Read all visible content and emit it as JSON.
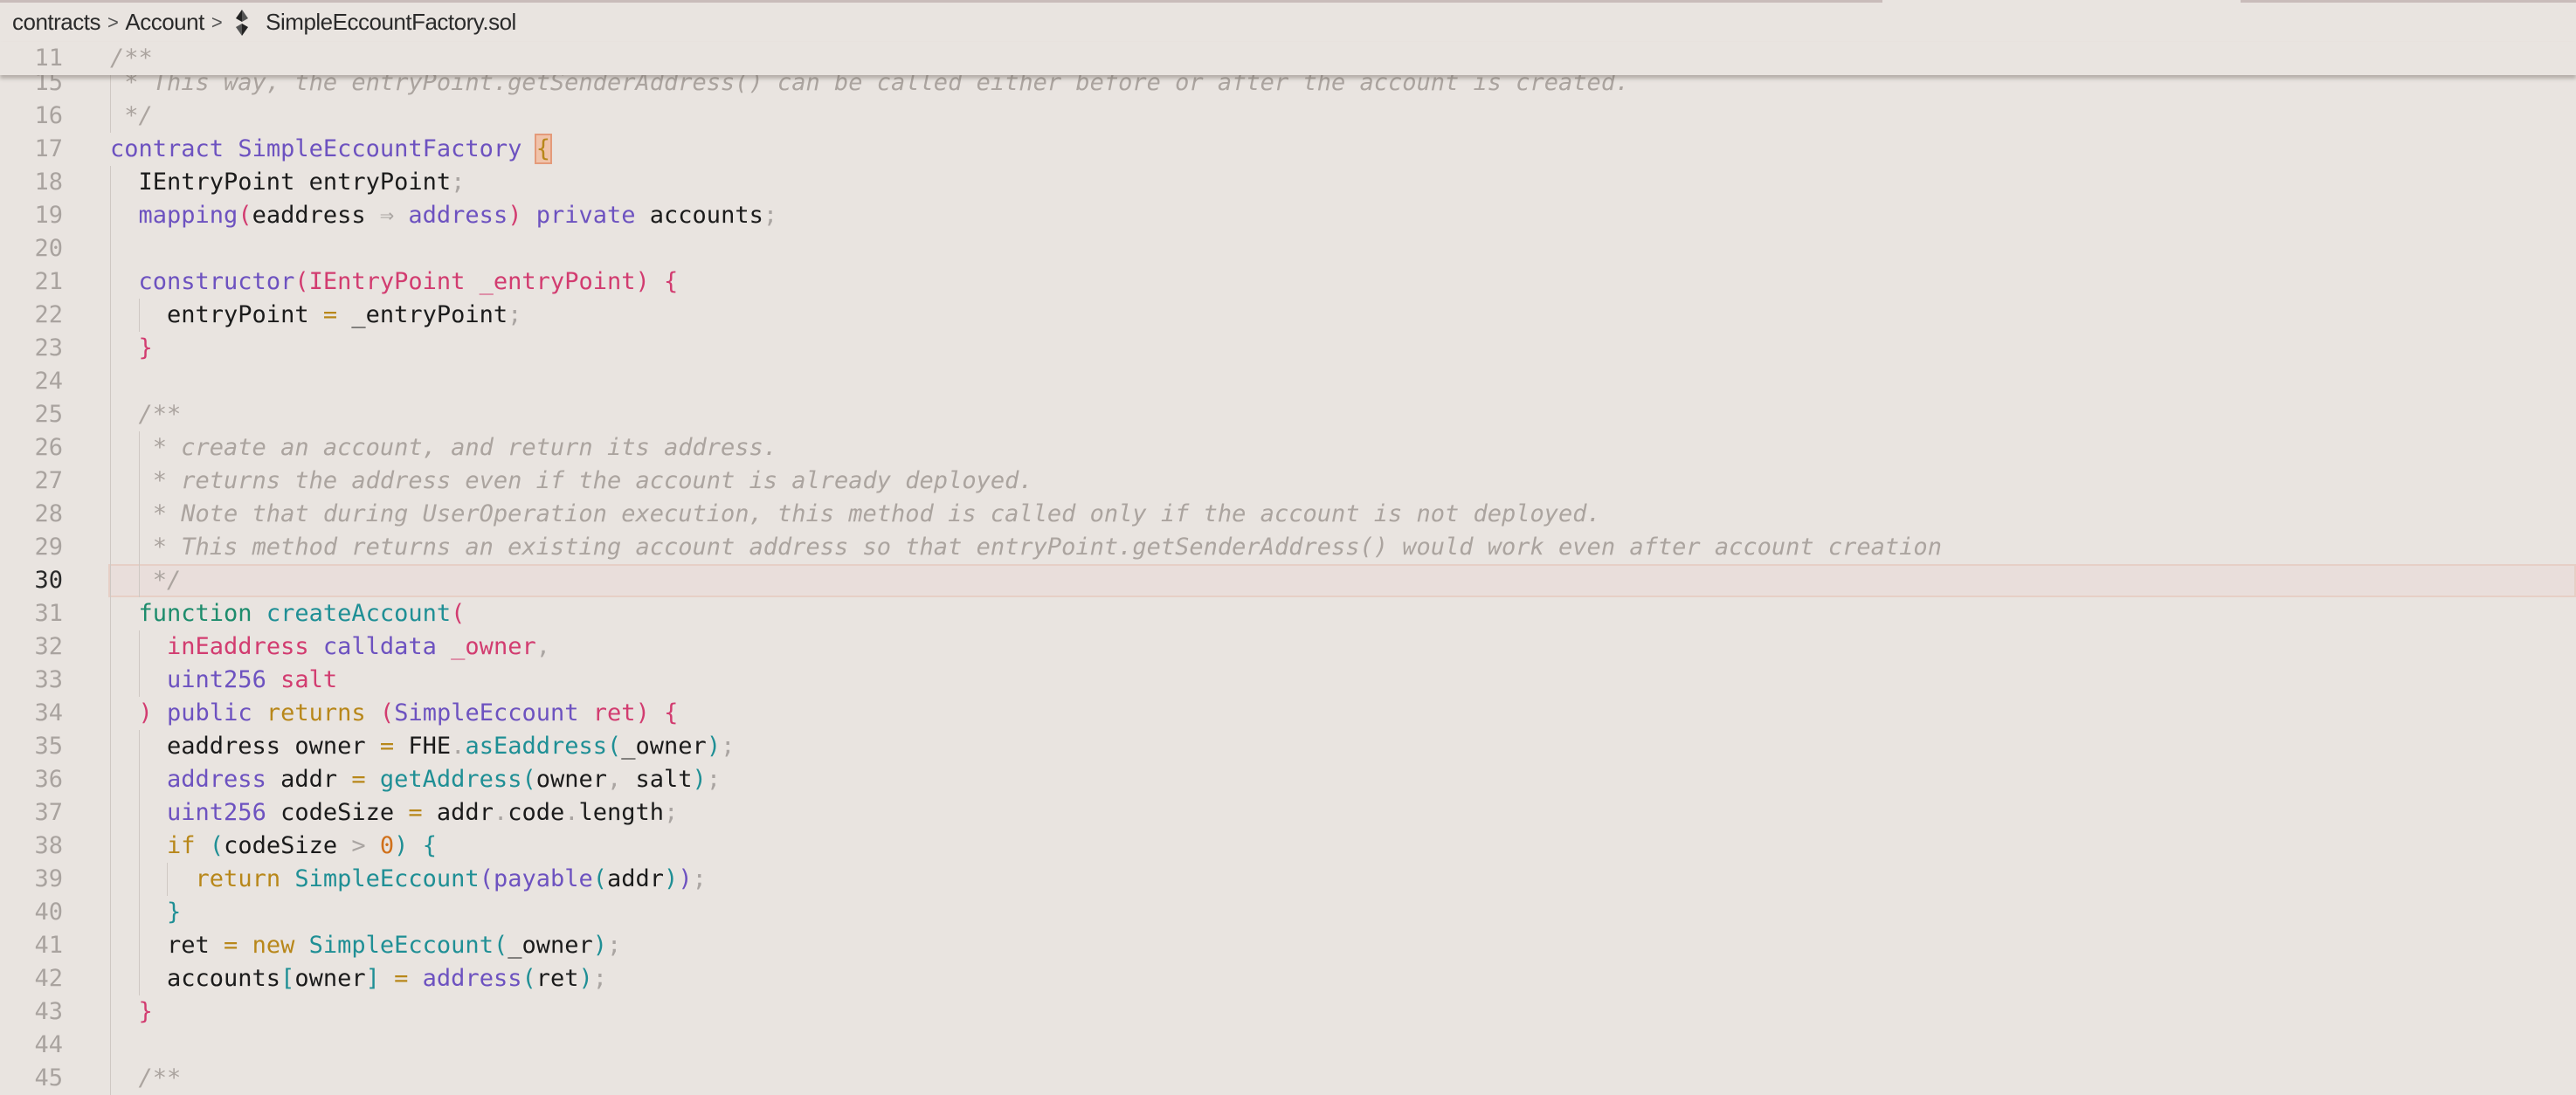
{
  "breadcrumb": {
    "items": [
      "contracts",
      "Account"
    ],
    "file": "SimpleEccountFactory.sol",
    "file_icon": "solidity-icon"
  },
  "colors": {
    "background": "#e9e4e0",
    "keyword": "#6d52c0",
    "pink": "#d23c70",
    "teal": "#1f8f95",
    "gold": "#b8871a",
    "comment": "#aba49f"
  },
  "editor": {
    "current_line": 30,
    "sticky": {
      "n": 11,
      "t": [
        [
          "/**",
          "c"
        ]
      ]
    },
    "lines": [
      {
        "n": 15,
        "t": [
          [
            " * This way, the entryPoint.getSenderAddress() can be called either before or after the account is created.",
            "c"
          ]
        ]
      },
      {
        "n": 16,
        "t": [
          [
            " */",
            "c"
          ]
        ]
      },
      {
        "n": 17,
        "t": [
          [
            "contract",
            "k"
          ],
          [
            " ",
            "d"
          ],
          [
            "SimpleEccountFactory",
            "k"
          ],
          [
            " ",
            "d"
          ],
          [
            "{",
            "bm"
          ]
        ]
      },
      {
        "n": 18,
        "t": [
          [
            "  IEntryPoint entryPoint",
            "d"
          ],
          [
            ";",
            "p"
          ]
        ]
      },
      {
        "n": 19,
        "t": [
          [
            "  ",
            "d"
          ],
          [
            "mapping",
            "k"
          ],
          [
            "(",
            "pk"
          ],
          [
            "eaddress",
            "d"
          ],
          [
            " ⇒ ",
            "p"
          ],
          [
            "address",
            "k"
          ],
          [
            ")",
            "pk"
          ],
          [
            " ",
            "d"
          ],
          [
            "private",
            "k"
          ],
          [
            " accounts",
            "d"
          ],
          [
            ";",
            "p"
          ]
        ]
      },
      {
        "n": 20,
        "t": []
      },
      {
        "n": 21,
        "t": [
          [
            "  ",
            "d"
          ],
          [
            "constructor",
            "k"
          ],
          [
            "(",
            "pk"
          ],
          [
            "IEntryPoint _entryPoint",
            "pk"
          ],
          [
            ") {",
            "pk"
          ]
        ]
      },
      {
        "n": 22,
        "t": [
          [
            "    entryPoint",
            "d"
          ],
          [
            " = ",
            "g"
          ],
          [
            "_entryPoint",
            "d"
          ],
          [
            ";",
            "p"
          ]
        ]
      },
      {
        "n": 23,
        "t": [
          [
            "  ",
            "d"
          ],
          [
            "}",
            "pk"
          ]
        ]
      },
      {
        "n": 24,
        "t": []
      },
      {
        "n": 25,
        "t": [
          [
            "  /**",
            "c"
          ]
        ]
      },
      {
        "n": 26,
        "t": [
          [
            "   * create an account, and return its address.",
            "c"
          ]
        ]
      },
      {
        "n": 27,
        "t": [
          [
            "   * returns the address even if the account is already deployed.",
            "c"
          ]
        ]
      },
      {
        "n": 28,
        "t": [
          [
            "   * Note that during UserOperation execution, this method is called only if the account is not deployed.",
            "c"
          ]
        ]
      },
      {
        "n": 29,
        "t": [
          [
            "   * This method returns an existing account address so that entryPoint.getSenderAddress() would work even after account creation",
            "c"
          ]
        ]
      },
      {
        "n": 30,
        "t": [
          [
            "   */",
            "c"
          ]
        ]
      },
      {
        "n": 31,
        "t": [
          [
            "  ",
            "d"
          ],
          [
            "function",
            "gr"
          ],
          [
            " ",
            "d"
          ],
          [
            "createAccount",
            "t"
          ],
          [
            "(",
            "pk"
          ]
        ]
      },
      {
        "n": 32,
        "t": [
          [
            "    ",
            "d"
          ],
          [
            "inEaddress",
            "pk"
          ],
          [
            " ",
            "d"
          ],
          [
            "calldata",
            "k"
          ],
          [
            " ",
            "d"
          ],
          [
            "_owner",
            "pk"
          ],
          [
            ",",
            "p"
          ]
        ]
      },
      {
        "n": 33,
        "t": [
          [
            "    ",
            "d"
          ],
          [
            "uint256",
            "k"
          ],
          [
            " ",
            "d"
          ],
          [
            "salt",
            "pk"
          ]
        ]
      },
      {
        "n": 34,
        "t": [
          [
            "  ",
            "d"
          ],
          [
            ")",
            "pk"
          ],
          [
            " ",
            "d"
          ],
          [
            "public",
            "k"
          ],
          [
            " ",
            "d"
          ],
          [
            "returns",
            "g"
          ],
          [
            " ",
            "d"
          ],
          [
            "(",
            "pk"
          ],
          [
            "SimpleEccount",
            "k"
          ],
          [
            " ",
            "d"
          ],
          [
            "ret",
            "pk"
          ],
          [
            ")",
            "pk"
          ],
          [
            " ",
            "d"
          ],
          [
            "{",
            "pk"
          ]
        ]
      },
      {
        "n": 35,
        "t": [
          [
            "    eaddress owner",
            "d"
          ],
          [
            " = ",
            "g"
          ],
          [
            "FHE",
            "d"
          ],
          [
            ".",
            "p"
          ],
          [
            "asEaddress",
            "t"
          ],
          [
            "(",
            "t"
          ],
          [
            "_owner",
            "d"
          ],
          [
            ")",
            "t"
          ],
          [
            ";",
            "p"
          ]
        ]
      },
      {
        "n": 36,
        "t": [
          [
            "    ",
            "d"
          ],
          [
            "address",
            "k"
          ],
          [
            " addr",
            "d"
          ],
          [
            " = ",
            "g"
          ],
          [
            "getAddress",
            "t"
          ],
          [
            "(",
            "t"
          ],
          [
            "owner",
            "d"
          ],
          [
            ", ",
            "p"
          ],
          [
            "salt",
            "d"
          ],
          [
            ")",
            "t"
          ],
          [
            ";",
            "p"
          ]
        ]
      },
      {
        "n": 37,
        "t": [
          [
            "    ",
            "d"
          ],
          [
            "uint256",
            "k"
          ],
          [
            " codeSize",
            "d"
          ],
          [
            " = ",
            "g"
          ],
          [
            "addr",
            "d"
          ],
          [
            ".",
            "p"
          ],
          [
            "code",
            "d"
          ],
          [
            ".",
            "p"
          ],
          [
            "length",
            "d"
          ],
          [
            ";",
            "p"
          ]
        ]
      },
      {
        "n": 38,
        "t": [
          [
            "    ",
            "d"
          ],
          [
            "if",
            "g"
          ],
          [
            " ",
            "d"
          ],
          [
            "(",
            "t"
          ],
          [
            "codeSize",
            "d"
          ],
          [
            " > ",
            "p"
          ],
          [
            "0",
            "o"
          ],
          [
            ")",
            "t"
          ],
          [
            " ",
            "d"
          ],
          [
            "{",
            "t"
          ]
        ]
      },
      {
        "n": 39,
        "t": [
          [
            "      ",
            "d"
          ],
          [
            "return",
            "g"
          ],
          [
            " ",
            "d"
          ],
          [
            "SimpleEccount",
            "t"
          ],
          [
            "(",
            "k"
          ],
          [
            "payable",
            "k"
          ],
          [
            "(",
            "t"
          ],
          [
            "addr",
            "d"
          ],
          [
            ")",
            "t"
          ],
          [
            ")",
            "k"
          ],
          [
            ";",
            "p"
          ]
        ]
      },
      {
        "n": 40,
        "t": [
          [
            "    ",
            "d"
          ],
          [
            "}",
            "t"
          ]
        ]
      },
      {
        "n": 41,
        "t": [
          [
            "    ret",
            "d"
          ],
          [
            " = ",
            "g"
          ],
          [
            "new",
            "g"
          ],
          [
            " ",
            "d"
          ],
          [
            "SimpleEccount",
            "t"
          ],
          [
            "(",
            "t"
          ],
          [
            "_owner",
            "d"
          ],
          [
            ")",
            "t"
          ],
          [
            ";",
            "p"
          ]
        ]
      },
      {
        "n": 42,
        "t": [
          [
            "    accounts",
            "d"
          ],
          [
            "[",
            "t"
          ],
          [
            "owner",
            "d"
          ],
          [
            "]",
            "t"
          ],
          [
            " = ",
            "g"
          ],
          [
            "address",
            "k"
          ],
          [
            "(",
            "t"
          ],
          [
            "ret",
            "d"
          ],
          [
            ")",
            "t"
          ],
          [
            ";",
            "p"
          ]
        ]
      },
      {
        "n": 43,
        "t": [
          [
            "  ",
            "d"
          ],
          [
            "}",
            "pk"
          ]
        ]
      },
      {
        "n": 44,
        "t": []
      },
      {
        "n": 45,
        "t": [
          [
            "  /**",
            "c"
          ]
        ]
      }
    ]
  }
}
